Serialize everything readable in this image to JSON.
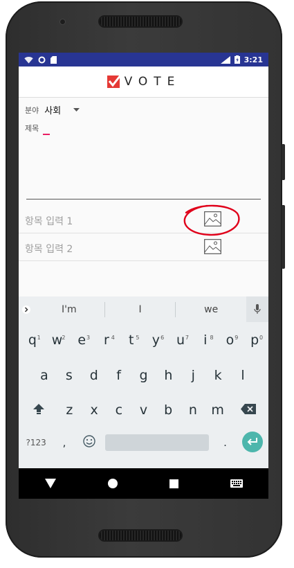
{
  "status_bar": {
    "time": "3:21",
    "network": "LTE"
  },
  "app_bar": {
    "logo_text": "VOTE",
    "logo_color": "#e53935"
  },
  "form": {
    "category_label": "분야",
    "category_value": "사회",
    "title_label": "제목",
    "items": [
      {
        "placeholder": "항목 입력 1"
      },
      {
        "placeholder": "항목 입력 2"
      }
    ],
    "annotation_color": "#e0001a"
  },
  "keyboard": {
    "suggestions": [
      "I'm",
      "I",
      "we"
    ],
    "row1": [
      {
        "k": "q",
        "n": "1"
      },
      {
        "k": "w",
        "n": "2"
      },
      {
        "k": "e",
        "n": "3"
      },
      {
        "k": "r",
        "n": "4"
      },
      {
        "k": "t",
        "n": "5"
      },
      {
        "k": "y",
        "n": "6"
      },
      {
        "k": "u",
        "n": "7"
      },
      {
        "k": "i",
        "n": "8"
      },
      {
        "k": "o",
        "n": "9"
      },
      {
        "k": "p",
        "n": "0"
      }
    ],
    "row2": [
      "a",
      "s",
      "d",
      "f",
      "g",
      "h",
      "j",
      "k",
      "l"
    ],
    "row3": [
      "z",
      "x",
      "c",
      "v",
      "b",
      "n",
      "m"
    ],
    "symbols_key": "?123",
    "comma_key": ",",
    "period_key": ".",
    "accent_color": "#4db6ac"
  }
}
